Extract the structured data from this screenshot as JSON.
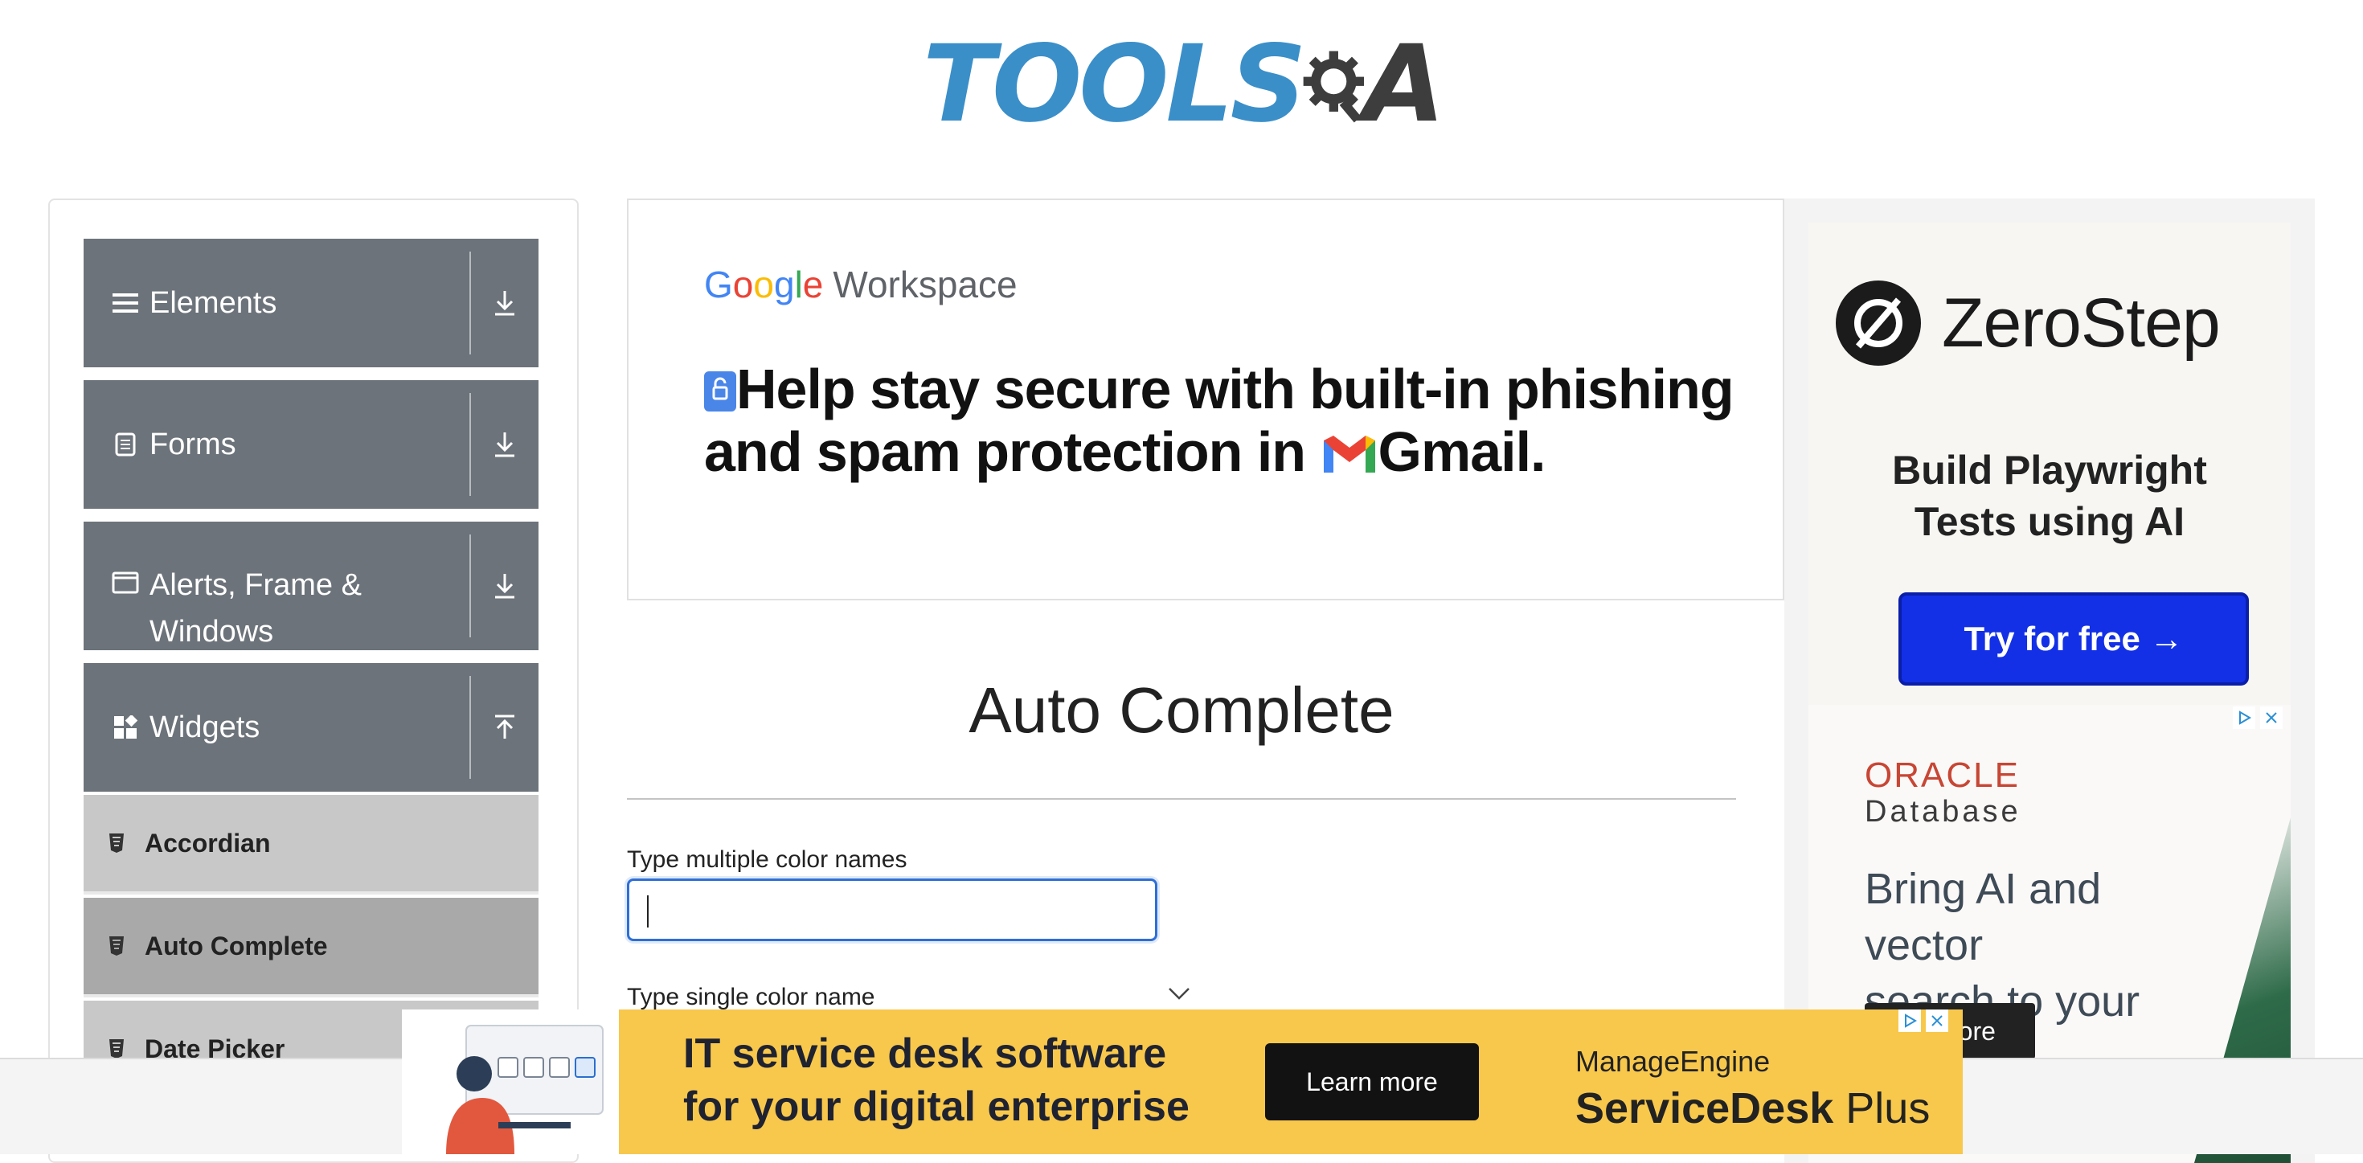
{
  "header": {
    "logo_left": "TOOLS",
    "logo_right": "A"
  },
  "sidebar": {
    "groups": [
      {
        "label": "Elements",
        "icon": "hamburger-icon",
        "arrow": "download-arrow-icon"
      },
      {
        "label": "Forms",
        "icon": "document-icon",
        "arrow": "download-arrow-icon"
      },
      {
        "label": "Alerts, Frame &",
        "label2": "Windows",
        "icon": "window-icon",
        "arrow": "download-arrow-icon"
      },
      {
        "label": "Widgets",
        "icon": "widgets-icon",
        "arrow": "upload-arrow-icon"
      }
    ],
    "items": [
      {
        "label": "Accordian",
        "active": false
      },
      {
        "label": "Auto Complete",
        "active": true
      },
      {
        "label": "Date Picker",
        "active": false
      }
    ]
  },
  "gw_ad": {
    "brand_google": "Google",
    "brand_product": "Workspace",
    "headline_line1": "Help stay secure with built-in phishing",
    "headline_line2_a": "and spam protection in ",
    "headline_line2_b": "Gmail."
  },
  "main": {
    "title": "Auto Complete",
    "multi_label": "Type multiple color names",
    "multi_value": "",
    "single_label": "Type single color name"
  },
  "right_ad": {
    "zs_name": "ZeroStep",
    "zs_tagline_1": "Build Playwright",
    "zs_tagline_2": "Tests using AI",
    "zs_button": "Try for free →",
    "oracle_name": "ORACLE",
    "oracle_sub": "Database",
    "oracle_text_1": "Bring AI and vector",
    "oracle_text_2": "search to your data",
    "oracle_button": "more"
  },
  "bottom_ad": {
    "line1": "IT service desk software",
    "line2": "for your digital enterprise",
    "button": "Learn more",
    "brand": "ManageEngine",
    "product_a": "ServiceDesk",
    "product_b": " Plus"
  },
  "colors": {
    "sidebar_group": "#6c737a",
    "sidebar_item": "#c8c8c8",
    "sidebar_item_active": "#a9a9a9",
    "input_focus": "#2f6fd6",
    "zerostep_button": "#1330e6",
    "oracle_red": "#c74634",
    "bottom_ad_bg": "#f8c84c",
    "logo_blue": "#3a8fc9"
  }
}
